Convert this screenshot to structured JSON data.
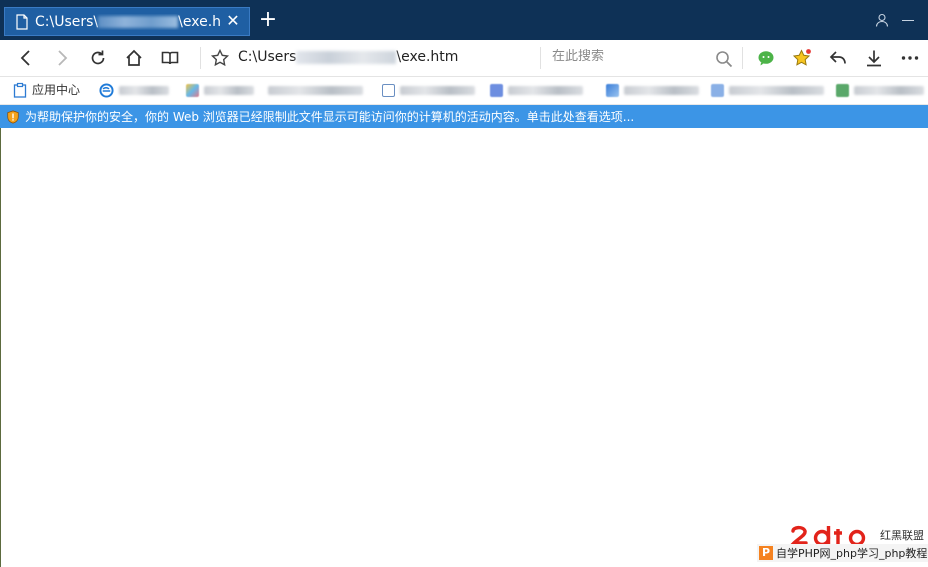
{
  "tab": {
    "title": "C:\\Users\\███████\\exe.htm",
    "title_prefix": "C:\\Users\\",
    "title_suffix": "\\exe.h"
  },
  "address": {
    "prefix": "C:\\Users",
    "suffix": "\\exe.htm"
  },
  "search": {
    "placeholder": "在此搜索"
  },
  "favorites": {
    "app_center": "应用中心"
  },
  "infobar": {
    "message": "为帮助保护你的安全，你的 Web 浏览器已经限制此文件显示可能访问你的计算机的活动内容。单击此处查看选项..."
  },
  "watermark": {
    "logo_text": "2cto",
    "site_cn": "红黑联盟",
    "caption": "自学PHP网_php学习_php教程"
  },
  "colors": {
    "titlebar": "#0e3156",
    "tab": "#1f5fa3",
    "infobar": "#3c95e6",
    "accent_orange": "#f58220"
  }
}
